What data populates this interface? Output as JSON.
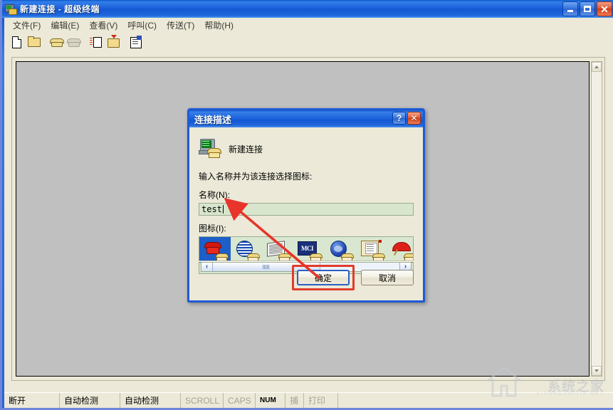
{
  "window": {
    "title": "新建连接 - 超级终端",
    "icon": "hyperterminal-icon",
    "controls": {
      "minimize": "–",
      "maximize": "□",
      "close": "✕"
    }
  },
  "menubar": {
    "items": [
      {
        "label": "文件(F)",
        "name": "menu-file"
      },
      {
        "label": "编辑(E)",
        "name": "menu-edit"
      },
      {
        "label": "查看(V)",
        "name": "menu-view"
      },
      {
        "label": "呼叫(C)",
        "name": "menu-call"
      },
      {
        "label": "传送(T)",
        "name": "menu-transfer"
      },
      {
        "label": "帮助(H)",
        "name": "menu-help"
      }
    ]
  },
  "toolbar": {
    "buttons": [
      {
        "name": "new-connection-icon",
        "title": "新建"
      },
      {
        "name": "open-folder-icon",
        "title": "打开"
      },
      {
        "name": "call-phone-icon",
        "title": "呼叫"
      },
      {
        "name": "hangup-phone-icon",
        "title": "断开",
        "disabled": true
      },
      {
        "name": "send-file-icon",
        "title": "发送"
      },
      {
        "name": "receive-file-icon",
        "title": "接收"
      },
      {
        "name": "properties-icon",
        "title": "属性"
      }
    ]
  },
  "dialog": {
    "title": "连接描述",
    "help_button": "?",
    "close_button": "✕",
    "connection_icon": "new-connection-computer-phone-icon",
    "connection_heading": "新建连接",
    "instruction": "输入名称并为该连接选择图标:",
    "name_label": "名称(N):",
    "name_value": "test",
    "name_placeholder": "",
    "icon_label": "图标(I):",
    "icons": [
      {
        "name": "icon-red-phone",
        "selected": true
      },
      {
        "name": "icon-striped-globe",
        "selected": false
      },
      {
        "name": "icon-newspaper",
        "selected": false
      },
      {
        "name": "icon-mci",
        "label": "MCI",
        "selected": false
      },
      {
        "name": "icon-blue-globe",
        "selected": false
      },
      {
        "name": "icon-document-stack",
        "selected": false
      },
      {
        "name": "icon-red-umbrella",
        "selected": false
      }
    ],
    "scroll_left": "‹",
    "scroll_right": "›",
    "ok_label": "确定",
    "cancel_label": "取消"
  },
  "statusbar": {
    "cells": [
      {
        "label": "断开",
        "name": "status-connection",
        "dim": false
      },
      {
        "label": "自动检测",
        "name": "status-autodetect-1",
        "dim": false
      },
      {
        "label": "自动检测",
        "name": "status-autodetect-2",
        "dim": false
      },
      {
        "label": "SCROLL",
        "name": "status-scroll",
        "dim": true
      },
      {
        "label": "CAPS",
        "name": "status-caps",
        "dim": true
      },
      {
        "label": "NUM",
        "name": "status-num",
        "dim": false
      },
      {
        "label": "捕",
        "name": "status-capture",
        "dim": true
      },
      {
        "label": "打印",
        "name": "status-print",
        "dim": true
      }
    ]
  },
  "annotation": {
    "arrow_color": "#e8342a",
    "highlight_color": "#e03c2a",
    "arrow_from": "确定",
    "arrow_to": "名称(N) 输入框"
  },
  "watermark": {
    "text": "系统之家",
    "subtext": "XITONGZHIJIA.NET"
  }
}
